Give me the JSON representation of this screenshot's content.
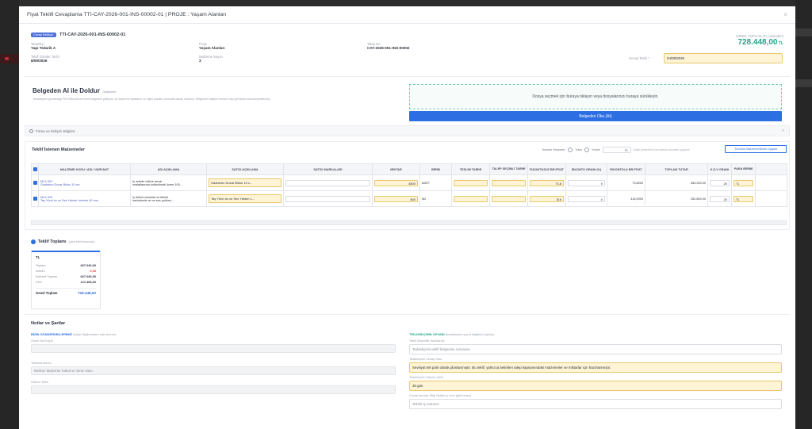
{
  "modal": {
    "title": "Fiyat Teklifi Cevaplama TTI-CAY-2026-001-INS-00002-01 | PROJE : Yaşam Alanları",
    "close": "×"
  },
  "header": {
    "status_badge": "Cevap Bekliyor",
    "doc_no": "TTI-CAY-2026-001-INS-00002-01",
    "fields": [
      {
        "label": "Tedarikçi",
        "value": "Yapı Tedarik A"
      },
      {
        "label": "Proje",
        "value": "Yaşam Alanları"
      },
      {
        "label": "Talep No",
        "value": "CAY-2026-001-INS-00002"
      },
      {
        "label": "Teklif Gönder Tarihi",
        "value": "8/09/2026"
      },
      {
        "label": "Malzeme Sayısı",
        "value": "3"
      }
    ],
    "grand_total_label": "GENEL TOPLAM (TL cinsinden)",
    "grand_total": "728.448,00",
    "grand_total_currency": "TL",
    "response_date_label": "Cevap Tarihi *",
    "response_date": "04/09/2026"
  },
  "ai": {
    "title": "Belgeden AI ile Doldur",
    "tag": "Opsiyonel",
    "desc": "Tedarikçinin gönderdiği PDF/Word/Excel teklif belgesini yükleyin; AI malzeme fiyatlarını ve diğer alanları otomatik olarak doldurur. Belgedeki bilgileri kontrol edip gerekirse düzenleyebilirsiniz.",
    "drop_text": "Dosya seçmek için buraya tıklayın veya dosyalarınızı buraya sürükleyin.",
    "button": "Belgeden Oku (AI)"
  },
  "company_section": {
    "title": "Firma ve İletişim Bilgileri"
  },
  "materials": {
    "title": "Teklif İstenen Malzemeler",
    "discount_label": "İskonto Seçenek:",
    "opt_none": "Tutar",
    "opt_percent": "Yüzde",
    "percent_value": "%",
    "note": "Değer girmezsiniz tüm satırlara otomatik uygulanır",
    "apply_button": "Tümüne Malzeme/Birimi Uygula",
    "columns": [
      "",
      "MALZEME KODU / ADI / VARYANT",
      "ADI AÇIKLAMA",
      "SATICI AÇIKLAMA",
      "SATICI MARKALARI",
      "MİKTAR",
      "BİRİM",
      "TESLİM TARİHİ",
      "TALEP SEÇİMLİ TARİHİ",
      "İSKONTOSUZ BR.FİYAT",
      "İSKONTO ORANI (%)",
      "İSKONTOLU BR.FİYAT",
      "TOPLAM TUTAR",
      "K.D.V ORANI",
      "PARA BİRİMİ"
    ],
    "rows": [
      {
        "no": "1",
        "code": "MLZ-001",
        "name": "Gazbeton Duvar Bloku 10 cm",
        "desc1": "İç mekân bölme duvar",
        "desc2": "imalatlarında kullanılmak üzere 100...",
        "seller_desc": "Gazbeton Duvar Bloku 10 c...",
        "brand": "",
        "qty": "4800",
        "unit": "ADET",
        "price": "73,8",
        "disc": "0",
        "disc_price": "73,8000",
        "total": "354.240,00",
        "vat": "20",
        "cur": "TL"
      },
      {
        "no": "2",
        "code": "MLZ-002",
        "name": "Taş Yünü Isı ve Ses Yalıtım Levhası 50 mm",
        "desc1": "İç bölme duvarlar ve teknik",
        "desc2": "hacimlerde ısı ve ses yalıtımı...",
        "seller_desc": "Taş Yünü Isı ve Ses Yalıtım L...",
        "brand": "",
        "qty": "800",
        "unit": "M2",
        "price": "316",
        "disc": "0",
        "disc_price": "316,0000",
        "total": "252.800,00",
        "vat": "20",
        "cur": "TL"
      }
    ]
  },
  "totals": {
    "title": "Teklif Toplamı",
    "subtitle": "(para birimi bazında)",
    "currency": "TL",
    "rows": [
      {
        "k": "Toplam",
        "v": "607.040,00"
      },
      {
        "k": "İndirim",
        "v": "0,00"
      },
      {
        "k": "İndirimli Toplam",
        "v": "607.040,00"
      },
      {
        "k": "KDV",
        "v": "121.408,00"
      }
    ],
    "grand_label": "Genel Toplam",
    "grand_value": "728.448,00"
  },
  "notes": {
    "title": "Notlar ve Şartlar",
    "left_title": "BİZİN GÖNDERDİKLERİMİZ",
    "left_sub": "(talep bilgilerinden salt okunur)",
    "left_fields": [
      {
        "label": "Genel Not Kayıtı",
        "value": ""
      },
      {
        "label": "Teslimat Adresi",
        "value": "Merkez Malzeme Kabul ve Sevk Alanı"
      },
      {
        "label": "Ödeme Şekli",
        "value": ""
      }
    ],
    "right_title": "TEDARİKÇİNİN CEVABI",
    "right_sub": "(tedarikçinin yazılı bilgilerini giriniz)",
    "right_fields": [
      {
        "label": "Teklif Geçerlilik Hazırlanışı",
        "value": "Tedarikçinin teklif belgesine numarası"
      },
      {
        "label": "Tedarikçinin Cevap Notu",
        "value": "Sevkiyat tek parti olarak planlanmıştır. Bu teklif, yalnızca belirtilen talep kapsamındaki malzemeler ve miktarlar için hazırlanmıştır."
      },
      {
        "label": "Tedarikçinin Ödeme Şekli",
        "value": "30 gün"
      },
      {
        "label": "Cevap formatı: Bilgi Notları iç notu (görünmez)",
        "value": "Teknik iç notunuz"
      }
    ]
  }
}
